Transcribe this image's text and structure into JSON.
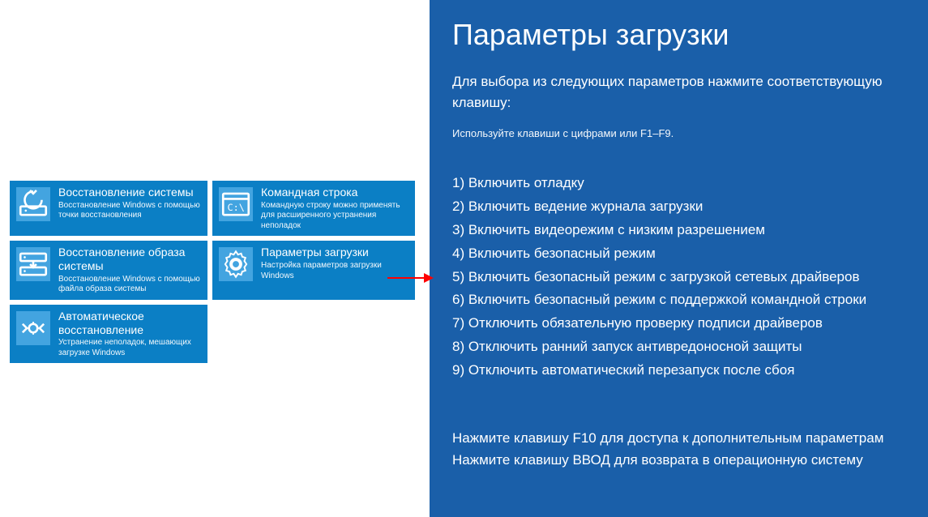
{
  "left": {
    "tiles": [
      {
        "title": "Восстановление системы",
        "desc": "Восстановление Windows с помощью точки восстановления"
      },
      {
        "title": "Командная строка",
        "desc": "Командную строку можно применять для расширенного устранения неполадок"
      },
      {
        "title": "Восстановление образа системы",
        "desc": "Восстановление Windows с помощью файла образа системы"
      },
      {
        "title": "Параметры загрузки",
        "desc": "Настройка параметров загрузки Windows"
      },
      {
        "title": "Автоматическое восстановление",
        "desc": "Устранение неполадок, мешающих загрузке Windows"
      }
    ]
  },
  "right": {
    "title": "Параметры загрузки",
    "subtitle": "Для выбора из следующих параметров нажмите соответствующую клавишу:",
    "hint": "Используйте клавиши с цифрами или F1–F9.",
    "options": [
      "1) Включить отладку",
      "2) Включить ведение журнала загрузки",
      "3) Включить видеорежим с низким разрешением",
      "4) Включить безопасный режим",
      "5) Включить безопасный режим с загрузкой сетевых драйверов",
      "6) Включить безопасный режим с поддержкой командной строки",
      "7) Отключить обязательную проверку подписи драйверов",
      "8) Отключить ранний запуск антивредоносной защиты",
      "9) Отключить автоматический перезапуск после сбоя"
    ],
    "footer1": "Нажмите клавишу F10 для доступа к дополнительным параметрам",
    "footer2": "Нажмите клавишу ВВОД для возврата в операционную систему"
  }
}
